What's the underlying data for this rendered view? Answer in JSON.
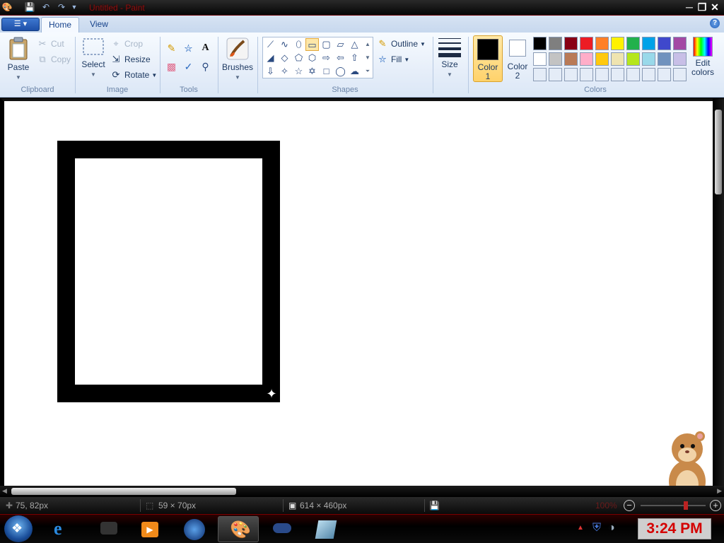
{
  "window": {
    "title": "Untitled - Paint"
  },
  "tabs": [
    {
      "label": "Home"
    },
    {
      "label": "View"
    }
  ],
  "ribbon": {
    "clipboard": {
      "paste": "Paste",
      "cut": "Cut",
      "copy": "Copy",
      "group": "Clipboard"
    },
    "image": {
      "select": "Select",
      "crop": "Crop",
      "resize": "Resize",
      "rotate": "Rotate",
      "group": "Image"
    },
    "tools": {
      "group": "Tools"
    },
    "brushes": {
      "label": "Brushes"
    },
    "shapes": {
      "outline": "Outline",
      "fill": "Fill",
      "group": "Shapes"
    },
    "size": {
      "label": "Size"
    },
    "colors": {
      "color1_line1": "Color",
      "color1_line2": "1",
      "color2_line1": "Color",
      "color2_line2": "2",
      "edit_line1": "Edit",
      "edit_line2": "colors",
      "group": "Colors",
      "color1_value": "#000000",
      "color2_value": "#ffffff",
      "palette_row1": [
        "#000000",
        "#7f7f7f",
        "#880015",
        "#ed1c24",
        "#ff7f27",
        "#fff200",
        "#22b14c",
        "#00a2e8",
        "#3f48cc",
        "#a349a4"
      ],
      "palette_row2": [
        "#ffffff",
        "#c3c3c3",
        "#b97a57",
        "#ffaec9",
        "#ffc90e",
        "#efe4b0",
        "#b5e61d",
        "#99d9ea",
        "#7092be",
        "#c8bfe7"
      ]
    }
  },
  "status": {
    "cursor_pos": "75, 82px",
    "selection_size": "59 × 70px",
    "image_size": "614 × 460px",
    "zoom": "100%"
  },
  "taskbar": {
    "clock": "3:24 PM"
  }
}
